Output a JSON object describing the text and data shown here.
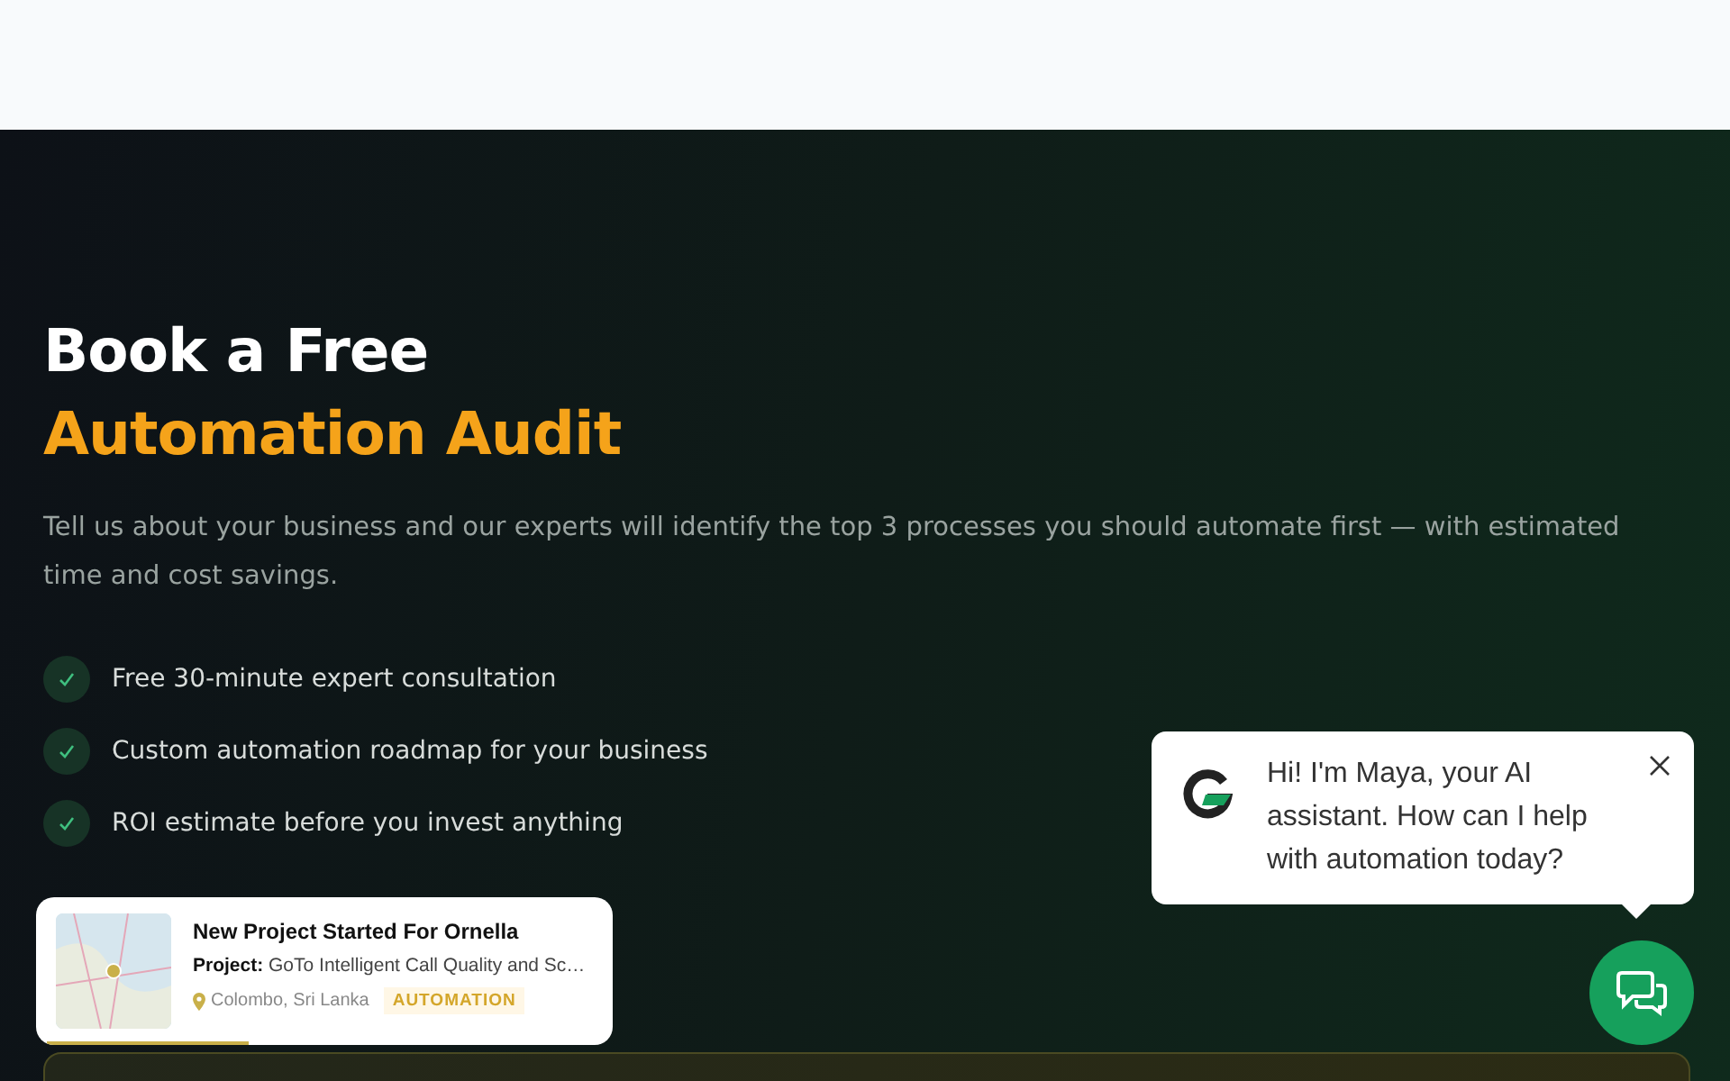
{
  "hero": {
    "title_line_1": "Book a Free",
    "title_line_2": "Automation Audit",
    "description": "Tell us about your business and our experts will identify the top 3 processes you should automate first — with estimated time and cost savings.",
    "benefits": [
      "Free 30-minute expert consultation",
      "Custom automation roadmap for your business",
      "ROI estimate before you invest anything"
    ]
  },
  "toast": {
    "title": "New Project Started For Ornella",
    "project_label": "Project:",
    "project": "GoTo Intelligent Call Quality and Sc…",
    "location": "Colombo, Sri Lanka",
    "tag": "AUTOMATION",
    "level": 0.35
  },
  "chat": {
    "message": "Hi! I'm Maya, your AI assistant. How can I help with automation today?"
  }
}
